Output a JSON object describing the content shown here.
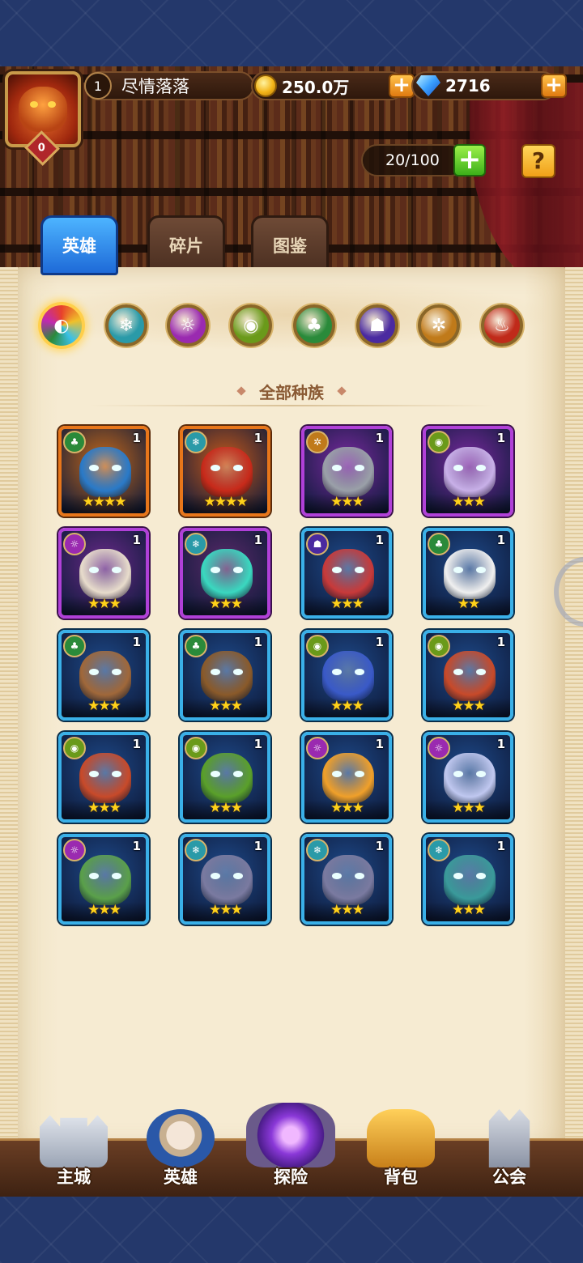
{
  "player": {
    "level": "1",
    "name": "尽情落落",
    "avatar_badge": "0"
  },
  "resources": {
    "gold": "250.0万",
    "gems": "2716",
    "plus": "+"
  },
  "roster": {
    "capacity": "20/100",
    "add": "+",
    "help": "?"
  },
  "tabs": [
    {
      "label": "英雄",
      "active": true
    },
    {
      "label": "碎片",
      "active": false
    },
    {
      "label": "图鉴",
      "active": false
    }
  ],
  "factions": [
    {
      "name": "all-factions",
      "color": "#e8502a",
      "glyph": "◐",
      "selected": true
    },
    {
      "name": "ice",
      "color": "#2a9aa8",
      "glyph": "❄",
      "selected": false
    },
    {
      "name": "arcane",
      "color": "#9a2ab0",
      "glyph": "☼",
      "selected": false
    },
    {
      "name": "eye",
      "color": "#6a9a1a",
      "glyph": "◉",
      "selected": false
    },
    {
      "name": "nature",
      "color": "#2a8a3a",
      "glyph": "♣",
      "selected": false
    },
    {
      "name": "shadow",
      "color": "#4a2aa0",
      "glyph": "☗",
      "selected": false
    },
    {
      "name": "light",
      "color": "#c07a1a",
      "glyph": "✲",
      "selected": false
    },
    {
      "name": "fire",
      "color": "#c02a1a",
      "glyph": "♨",
      "selected": false
    }
  ],
  "section_title": "全部种族",
  "heroes": [
    {
      "frame": "orange",
      "faction": "nature",
      "level": "1",
      "stars": "★★★★",
      "bg": "#c86a1a",
      "face": "#2a7ac8"
    },
    {
      "frame": "orange",
      "faction": "ice",
      "level": "1",
      "stars": "★★★★",
      "bg": "#c85a1a",
      "face": "#c82a1a"
    },
    {
      "frame": "purple",
      "faction": "light",
      "level": "1",
      "stars": "★★★",
      "bg": "#7a2aa0",
      "face": "#9aa0a8"
    },
    {
      "frame": "purple",
      "faction": "eye",
      "level": "1",
      "stars": "★★★",
      "bg": "#7a2aa0",
      "face": "#c8b0e8"
    },
    {
      "frame": "purple",
      "faction": "arcane",
      "level": "1",
      "stars": "★★★",
      "bg": "#6a2a8a",
      "face": "#e8dccc"
    },
    {
      "frame": "purple",
      "faction": "ice",
      "level": "1",
      "stars": "★★★",
      "bg": "#5a2a6a",
      "face": "#3ad8c0"
    },
    {
      "frame": "blue",
      "faction": "shadow",
      "level": "1",
      "stars": "★★★",
      "bg": "#1e4a8a",
      "face": "#c83a3a"
    },
    {
      "frame": "blue",
      "faction": "nature",
      "level": "1",
      "stars": "★★",
      "bg": "#1e4a8a",
      "face": "#f0f0f0"
    },
    {
      "frame": "blue",
      "faction": "nature",
      "level": "1",
      "stars": "★★★",
      "bg": "#1e4a8a",
      "face": "#a0683a"
    },
    {
      "frame": "blue",
      "faction": "nature",
      "level": "1",
      "stars": "★★★",
      "bg": "#1e4a8a",
      "face": "#8a5a2a"
    },
    {
      "frame": "blue",
      "faction": "eye",
      "level": "1",
      "stars": "★★★",
      "bg": "#1e4a8a",
      "face": "#3a5ac8"
    },
    {
      "frame": "blue",
      "faction": "eye",
      "level": "1",
      "stars": "★★★",
      "bg": "#1e4a8a",
      "face": "#c84a2a"
    },
    {
      "frame": "blue",
      "faction": "eye",
      "level": "1",
      "stars": "★★★",
      "bg": "#1e4a8a",
      "face": "#c84a2a"
    },
    {
      "frame": "blue",
      "faction": "eye",
      "level": "1",
      "stars": "★★★",
      "bg": "#1e4a8a",
      "face": "#5aa02a"
    },
    {
      "frame": "blue",
      "faction": "arcane",
      "level": "1",
      "stars": "★★★",
      "bg": "#1e4a8a",
      "face": "#f0a02a"
    },
    {
      "frame": "blue",
      "faction": "arcane",
      "level": "1",
      "stars": "★★★",
      "bg": "#1e4a8a",
      "face": "#c0c8f0"
    },
    {
      "frame": "blue",
      "faction": "arcane",
      "level": "1",
      "stars": "★★★",
      "bg": "#1e4a8a",
      "face": "#5aa04a"
    },
    {
      "frame": "blue",
      "faction": "ice",
      "level": "1",
      "stars": "★★★",
      "bg": "#1e4a8a",
      "face": "#7a7aa0"
    },
    {
      "frame": "blue",
      "faction": "ice",
      "level": "1",
      "stars": "★★★",
      "bg": "#1e4a8a",
      "face": "#7a7aa0"
    },
    {
      "frame": "blue",
      "faction": "ice",
      "level": "1",
      "stars": "★★★",
      "bg": "#1e4a8a",
      "face": "#3a9a9a"
    }
  ],
  "bottom_nav": [
    {
      "label": "主城",
      "icon": "castle-icon"
    },
    {
      "label": "英雄",
      "icon": "hero-icon"
    },
    {
      "label": "探险",
      "icon": "explore-icon"
    },
    {
      "label": "背包",
      "icon": "bag-icon"
    },
    {
      "label": "公会",
      "icon": "guild-icon"
    }
  ]
}
